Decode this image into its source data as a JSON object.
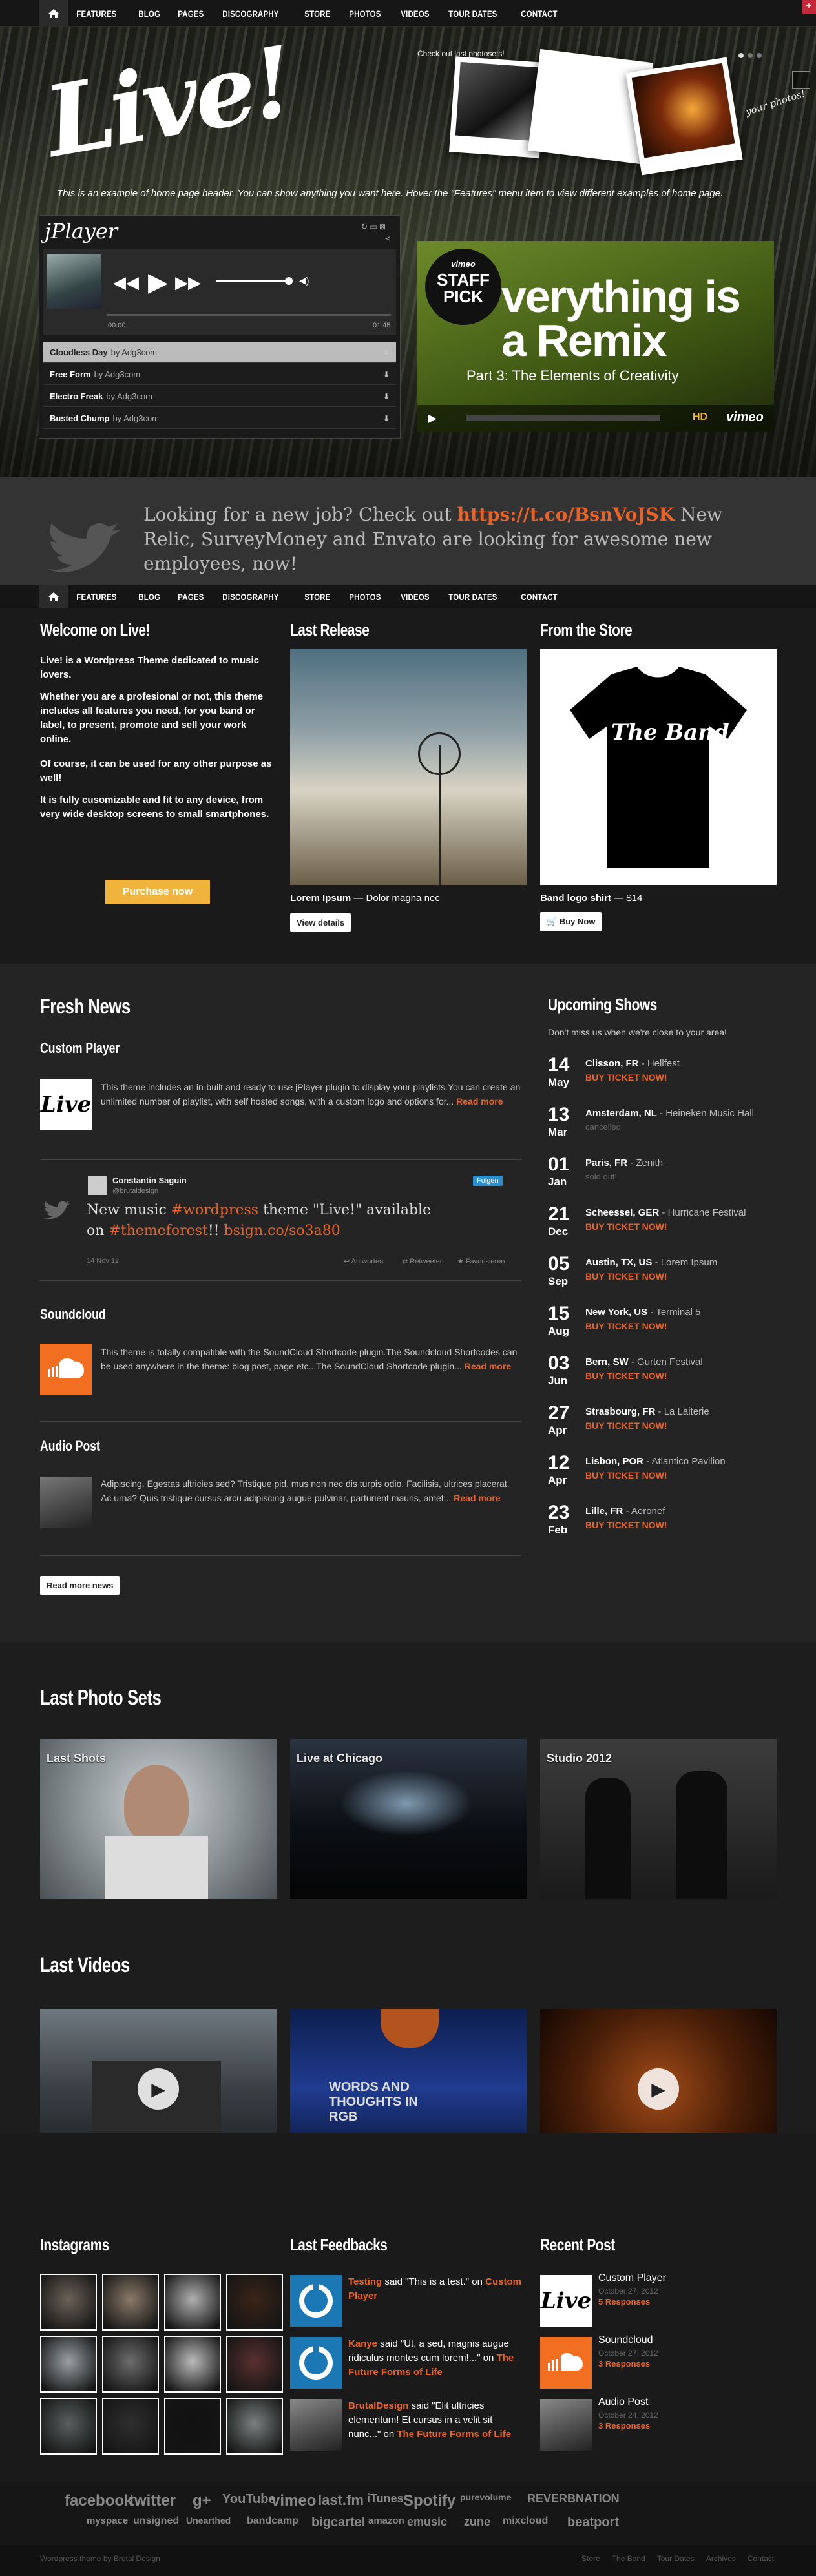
{
  "nav": {
    "items": [
      "FEATURES",
      "BLOG",
      "PAGES",
      "DISCOGRAPHY",
      "STORE",
      "PHOTOS",
      "VIDEOS",
      "TOUR DATES",
      "CONTACT"
    ]
  },
  "hero": {
    "logo": "Live!",
    "caption": "This is an example of home page header. You can show anything you want here. Hover the \"Features\" menu item to view different examples of home page.",
    "checkout": "Check out last photosets!",
    "handwritten_note": "your photos!"
  },
  "player": {
    "title": "jPlayer",
    "time_current": "00:00",
    "time_total": "01:45",
    "tracks": [
      {
        "name": "Cloudless Day",
        "by": "by Adg3com"
      },
      {
        "name": "Free Form",
        "by": "by Adg3com"
      },
      {
        "name": "Electro Freak",
        "by": "by Adg3com"
      },
      {
        "name": "Busted Chump",
        "by": "by Adg3com"
      }
    ]
  },
  "video": {
    "badge_top": "vimeo",
    "badge": "STAFF PICK",
    "headline": "verything is a Remix",
    "subtitle": "Part 3: The Elements of Creativity",
    "brand": "vimeo",
    "hd": "HD"
  },
  "tweet": {
    "text_before": "Looking for a new job? Check out ",
    "link": "https://t.co/BsnVoJSK",
    "text_after": " New Relic, SurveyMoney and Envato are looking for awesome new employees, now!"
  },
  "welcome": {
    "title": "Welcome on Live!",
    "p1": "Live! is a Wordpress Theme dedicated to music lovers.",
    "p2": "Whether you are a profesional or not, this theme includes all features you need, for you band or label, to present, promote and sell your work online.",
    "p3": "Of course, it can be used for any other purpose as well!",
    "p4": "It is fully cusomizable and fit to any device, from very wide desktop screens to small smartphones.",
    "button": "Purchase now"
  },
  "last_release": {
    "title": "Last Release",
    "name": "Lorem Ipsum",
    "desc": "— Dolor magna nec",
    "button": "View details"
  },
  "store": {
    "title": "From the Store",
    "shirt_text": "The Band",
    "name": "Band logo shirt",
    "price": "— $14",
    "button": "Buy Now"
  },
  "news": {
    "title": "Fresh News",
    "posts": [
      {
        "title": "Custom Player",
        "text": "This theme includes an in-built and ready to use jPlayer plugin to display your playlists.You can create an unlimited number of playlist, with self hosted songs, with a custom logo and options for...",
        "more": "Read more"
      },
      {
        "title": "Soundcloud",
        "text": "This theme is totally compatible with the SoundCloud Shortcode plugin.The Soundcloud Shortcodes can be used anywhere in the theme: blog post,  page etc...The SoundCloud Shortcode plugin...",
        "more": "Read more"
      },
      {
        "title": "Audio Post",
        "text": "Adipiscing. Egestas ultricies sed? Tristique pid, mus non nec dis turpis odio. Facilisis, ultrices placerat. Ac urna? Quis tristique cursus arcu adipiscing augue pulvinar, parturient mauris, amet...",
        "more": "Read more"
      }
    ],
    "embedded_tweet": {
      "name": "Constantin Saguin",
      "handle": "@brutaldesign",
      "follow": "Folgen",
      "text_a": "New music ",
      "tag1": "#wordpress",
      "text_b": " theme \"Live!\" available on ",
      "tag2": "#themeforest",
      "text_c": "!! ",
      "link": "bsign.co/so3a80",
      "date": "14 Nov 12",
      "actions": [
        "Antworten",
        "Retweeten",
        "Favorisieren"
      ]
    },
    "button": "Read more news"
  },
  "shows": {
    "title": "Upcoming Shows",
    "subtitle": "Don't miss us when we're close to your area!",
    "items": [
      {
        "day": "14",
        "month": "May",
        "city": "Clisson, FR",
        "venue": "Hellfest",
        "status": "BUY TICKET NOW!",
        "sold": false
      },
      {
        "day": "13",
        "month": "Mar",
        "city": "Amsterdam, NL",
        "venue": "Heineken Music Hall",
        "status": "cancelled",
        "sold": true
      },
      {
        "day": "01",
        "month": "Jan",
        "city": "Paris, FR",
        "venue": "Zenith",
        "status": "sold out!",
        "sold": true
      },
      {
        "day": "21",
        "month": "Dec",
        "city": "Scheessel, GER",
        "venue": "Hurricane Festival",
        "status": "BUY TICKET NOW!",
        "sold": false
      },
      {
        "day": "05",
        "month": "Sep",
        "city": "Austin, TX, US",
        "venue": "Lorem Ipsum",
        "status": "BUY TICKET NOW!",
        "sold": false
      },
      {
        "day": "15",
        "month": "Aug",
        "city": "New York, US",
        "venue": "Terminal 5",
        "status": "BUY TICKET NOW!",
        "sold": false
      },
      {
        "day": "03",
        "month": "Jun",
        "city": "Bern, SW",
        "venue": "Gurten Festival",
        "status": "BUY TICKET NOW!",
        "sold": false
      },
      {
        "day": "27",
        "month": "Apr",
        "city": "Strasbourg, FR",
        "venue": "La Laiterie",
        "status": "BUY TICKET NOW!",
        "sold": false
      },
      {
        "day": "12",
        "month": "Apr",
        "city": "Lisbon, POR",
        "venue": "Atlantico Pavilion",
        "status": "BUY TICKET NOW!",
        "sold": false
      },
      {
        "day": "23",
        "month": "Feb",
        "city": "Lille, FR",
        "venue": "Aeronef",
        "status": "BUY TICKET NOW!",
        "sold": false
      }
    ]
  },
  "photos": {
    "title": "Last Photo Sets",
    "sets": [
      "Last Shots",
      "Live at Chicago",
      "Studio 2012"
    ]
  },
  "videos": {
    "title": "Last Videos",
    "overlay": "WORDS AND THOUGHTS IN RGB"
  },
  "instagrams": {
    "title": "Instagrams"
  },
  "feedbacks": {
    "title": "Last Feedbacks",
    "items": [
      {
        "author": "Testing",
        "said": " said \"This is a test.\" on ",
        "post": "Custom Player"
      },
      {
        "author": "Kanye",
        "said": " said \"Ut, a sed, magnis augue ridiculus montes cum lorem!...\" on ",
        "post": "The Future Forms of Life"
      },
      {
        "author": "BrutalDesign",
        "said": " said \"Elit ultricies elementum! Et cursus in a velit sit nunc...\" on ",
        "post": "The Future Forms of Life"
      }
    ]
  },
  "recent": {
    "title": "Recent Post",
    "items": [
      {
        "title": "Custom Player",
        "date": "October 27, 2012",
        "resp": "5 Responses"
      },
      {
        "title": "Soundcloud",
        "date": "October 27, 2012",
        "resp": "3 Responses"
      },
      {
        "title": "Audio Post",
        "date": "October 24, 2012",
        "resp": "3 Responses"
      }
    ]
  },
  "brands": {
    "row1": [
      "facebook",
      "twitter",
      "g+",
      "YouTube",
      "vimeo",
      "last.fm",
      "iTunes",
      "Spotify",
      "purevolume",
      "REVERBNATION"
    ],
    "row2": [
      "myspace",
      "unsigned",
      "Unearthed",
      "bandcamp",
      "bigcartel",
      "amazon",
      "emusic",
      "zune",
      "mixcloud",
      "beatport"
    ]
  },
  "footer": {
    "left": "Wordpress theme by Brutal Design",
    "links": [
      "Store",
      "The Band",
      "Tour Dates",
      "Archives",
      "Contact"
    ]
  },
  "colors": {
    "accent": "#e8622a",
    "button_yellow": "#f0b43c",
    "background": "#1e1e1e"
  }
}
